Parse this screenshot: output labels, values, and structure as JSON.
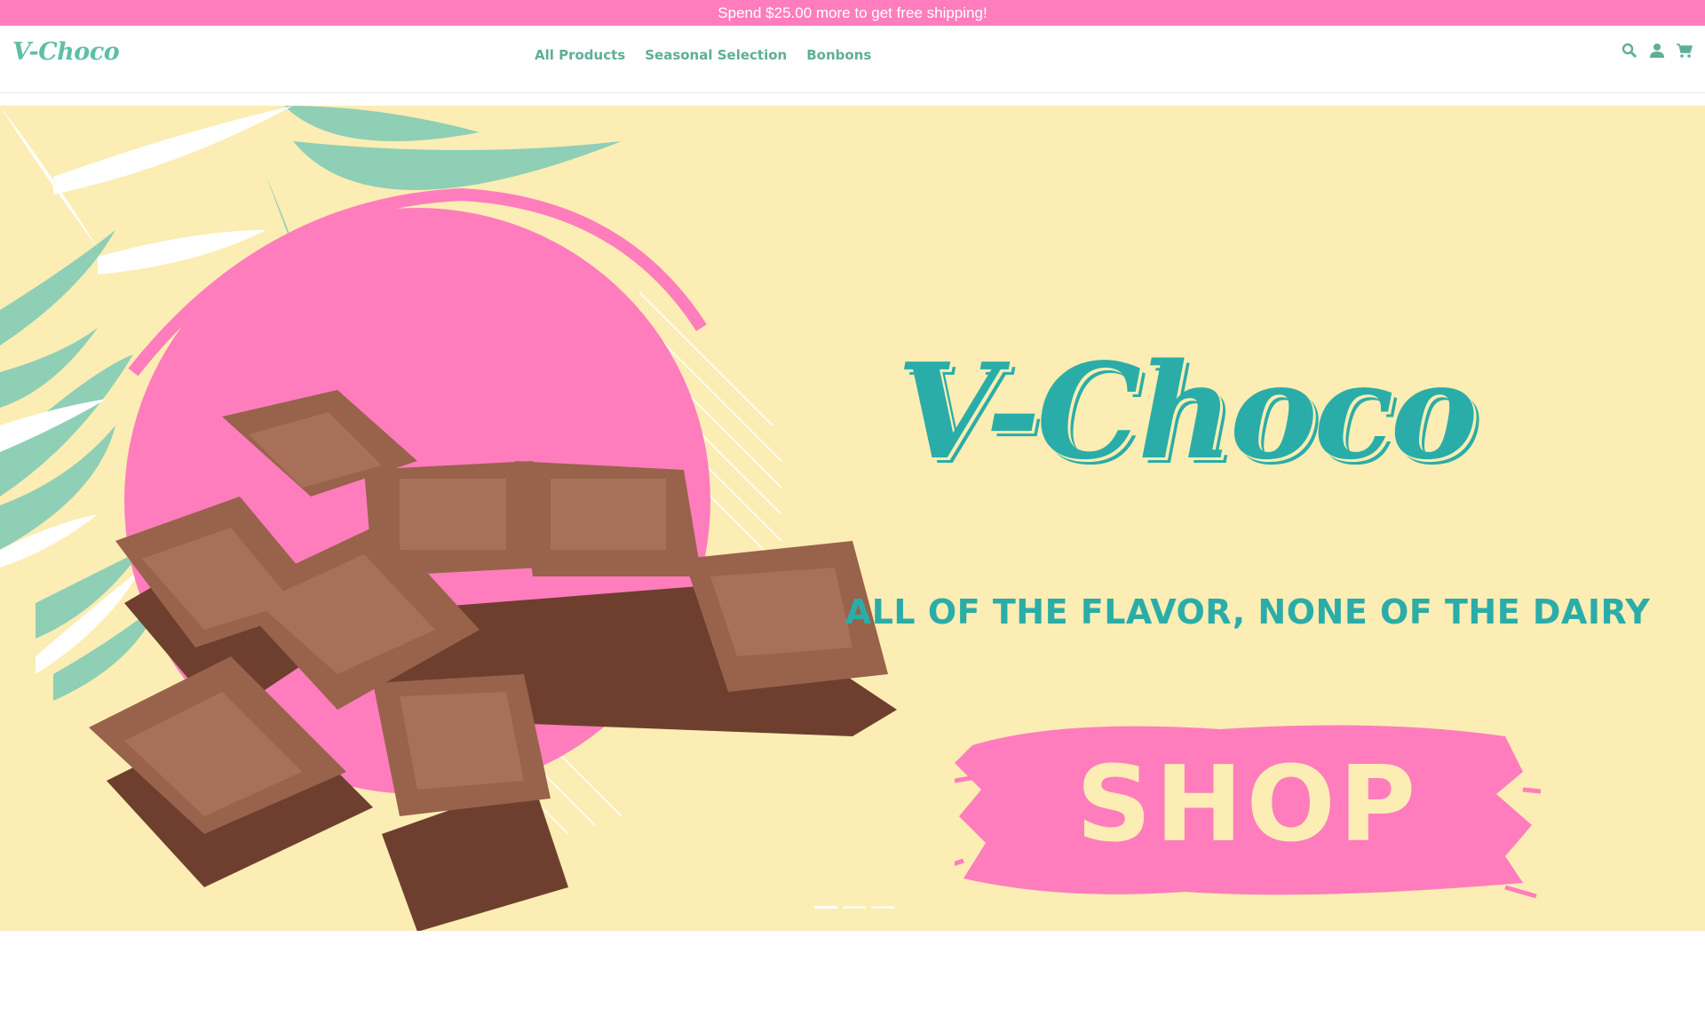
{
  "announcement": {
    "text": "Spend $25.00 more to get free shipping!"
  },
  "header": {
    "logo": "V-Choco",
    "nav": [
      {
        "label": "All Products"
      },
      {
        "label": "Seasonal Selection"
      },
      {
        "label": "Bonbons"
      }
    ],
    "icons": [
      "search-icon",
      "account-icon",
      "cart-icon"
    ]
  },
  "hero": {
    "title": "V-Choco",
    "tagline": "ALL OF THE FLAVOR, NONE OF THE DAIRY",
    "cta": "SHOP",
    "slides_count": 3,
    "active_slide": 1
  },
  "colors": {
    "accent_pink": "#ff7dbd",
    "accent_teal": "#2aada8",
    "leaf_green": "#8ecfb6",
    "hero_bg": "#fbedb3",
    "chocolate": "#8d5a45"
  }
}
